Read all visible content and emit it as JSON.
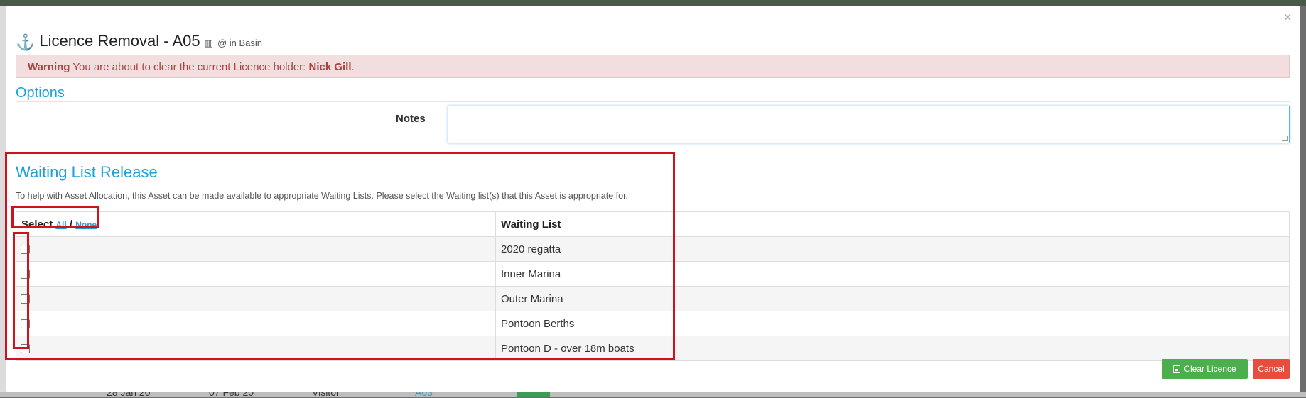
{
  "modal": {
    "title": "Licence Removal - A05",
    "title_sub": "@ in Basin",
    "close_glyph": "×",
    "warning": {
      "label": "Warning",
      "text": "You are about to clear the current Licence holder:",
      "holder": "Nick Gill",
      "end": "."
    },
    "options": {
      "heading": "Options",
      "notes_label": "Notes",
      "notes_value": ""
    },
    "waiting_list": {
      "heading": "Waiting List Release",
      "description": "To help with Asset Allocation, this Asset can be made available to appropriate Waiting Lists. Please select the Waiting list(s) that this Asset is appropriate for.",
      "select_label": "Select",
      "all_label": "All",
      "separator": "/",
      "none_label": "None",
      "column_header": "Waiting List",
      "rows": [
        {
          "name": "2020 regatta",
          "checked": false
        },
        {
          "name": "Inner Marina",
          "checked": false
        },
        {
          "name": "Outer Marina",
          "checked": false
        },
        {
          "name": "Pontoon Berths",
          "checked": false
        },
        {
          "name": "Pontoon D - over 18m boats",
          "checked": false
        }
      ]
    },
    "buttons": {
      "clear_licence": "Clear Licence",
      "cancel": "Cancel"
    }
  },
  "background": {
    "row_text": [
      "28 Jan 20",
      "07 Feb 20",
      "Visitor",
      "A03"
    ]
  },
  "colors": {
    "accent": "#1ea1d8",
    "highlight": "#d0121b",
    "warning_bg": "#f2dede",
    "success": "#4cae4c",
    "danger": "#e74c3c"
  },
  "icons": {
    "title_icon": "anchor-icon",
    "building_icon": "building-icon",
    "save_icon": "save-icon"
  }
}
